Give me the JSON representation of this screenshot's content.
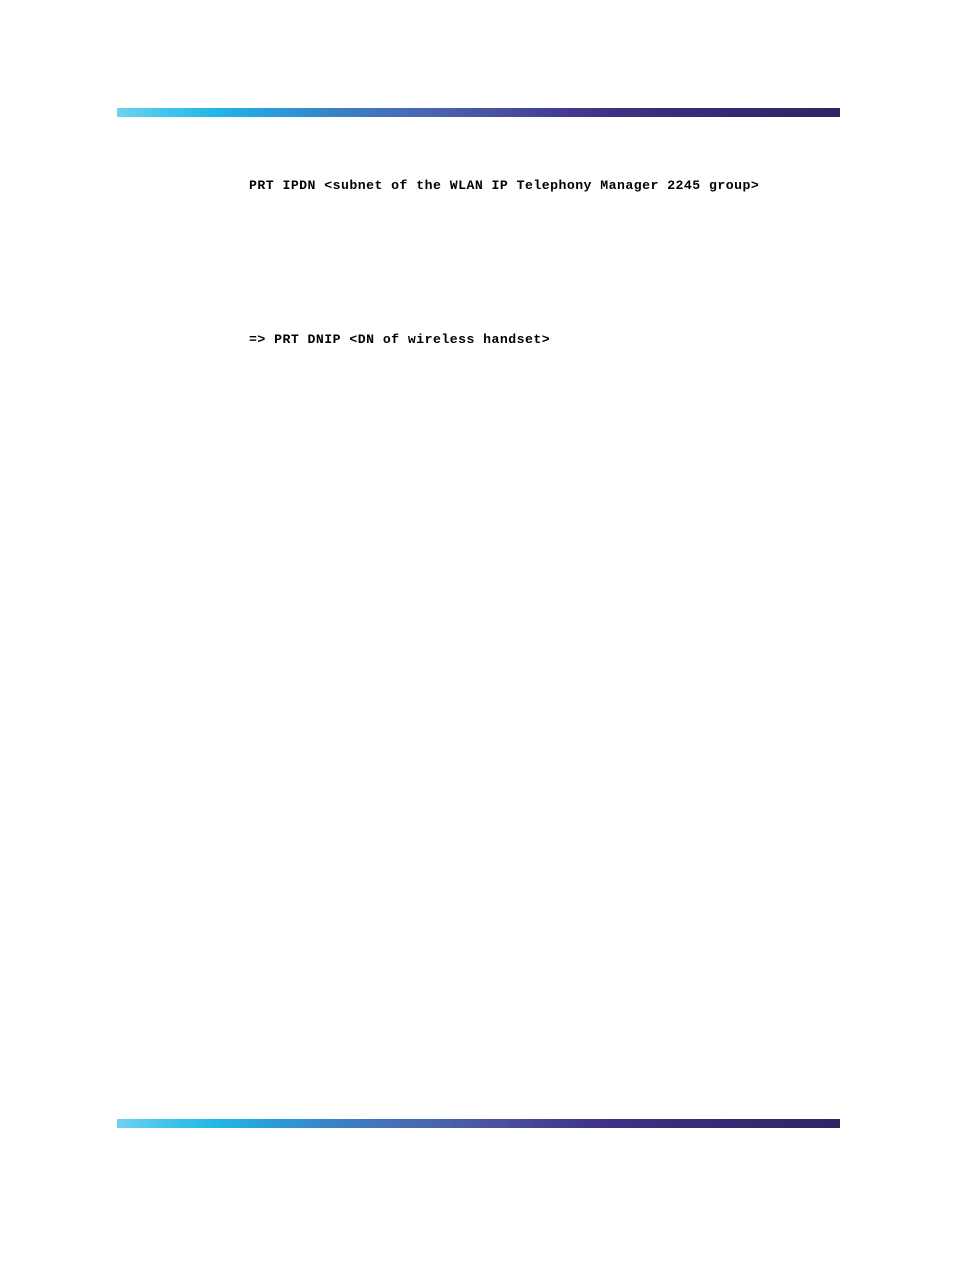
{
  "document": {
    "page_background": "#ffffff",
    "rule_gradient": {
      "start_color": "#6fd3ef",
      "mid_color": "#4571b8",
      "end_color": "#2e2663"
    }
  },
  "header": {
    "rule_name": "header-gradient-rule"
  },
  "footer": {
    "rule_name": "footer-gradient-rule"
  },
  "content": {
    "code_lines": [
      {
        "text": "PRT IPDN <subnet of the WLAN IP Telephony Manager 2245 group>"
      },
      {
        "text": "=> PRT DNIP <DN of wireless handset>"
      }
    ]
  }
}
